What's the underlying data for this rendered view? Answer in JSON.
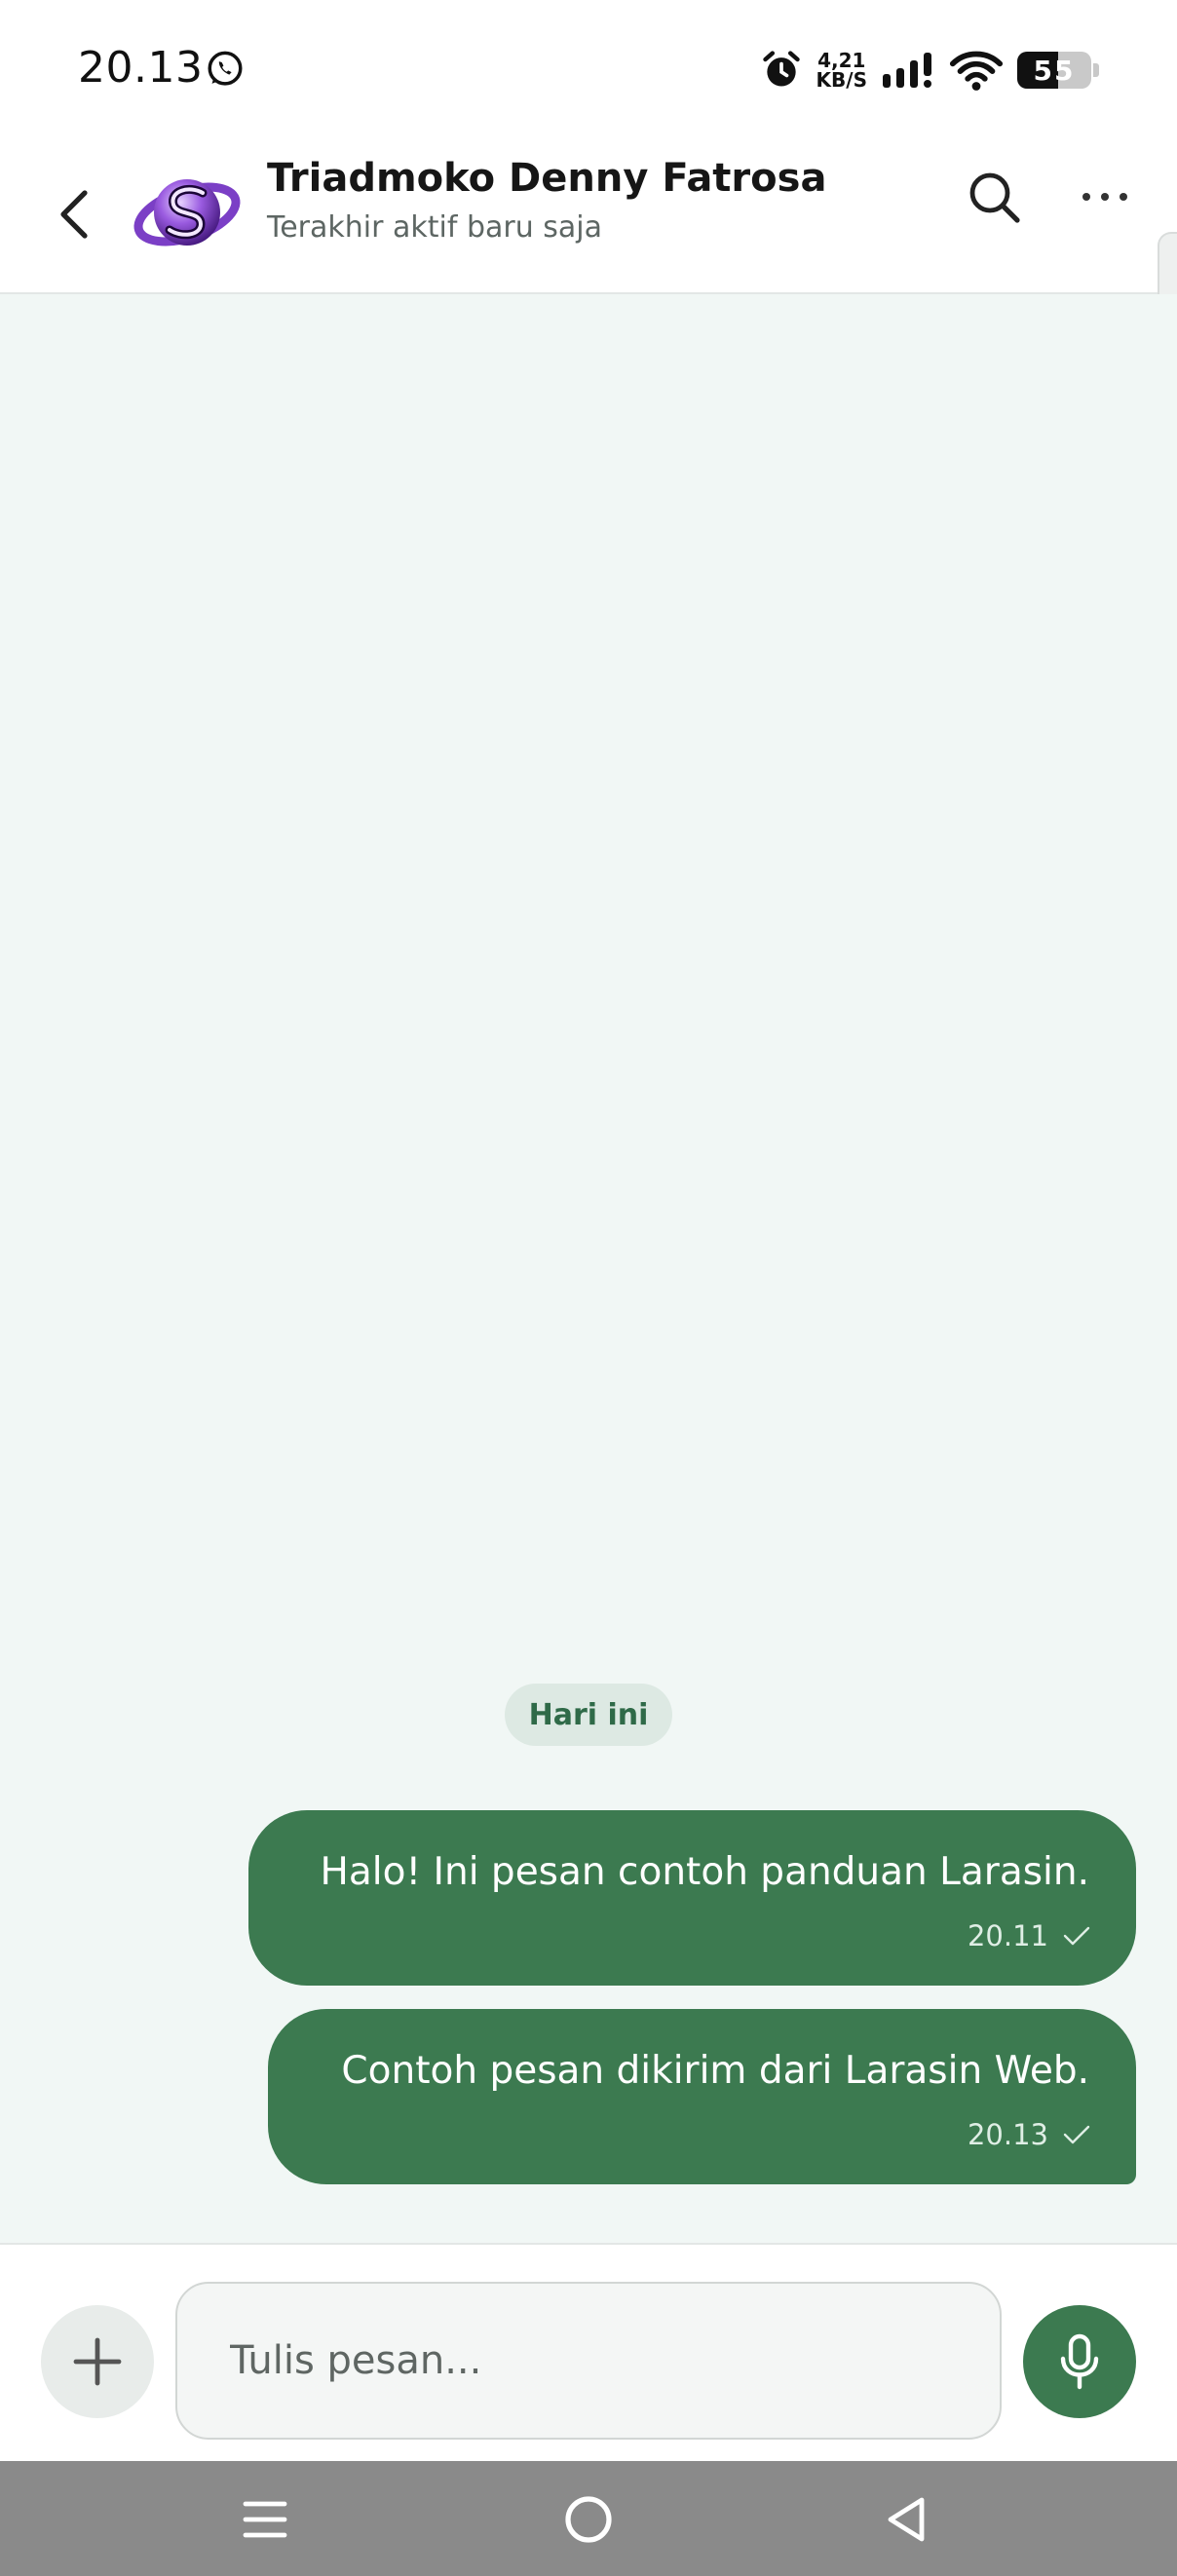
{
  "status_bar": {
    "time": "20.13",
    "net_speed_value": "4,21",
    "net_speed_unit": "KB/S",
    "battery_level": "55",
    "battery_fraction": 0.55,
    "icons": [
      "whatsapp-icon",
      "alarm-icon",
      "signal-icon",
      "wifi-icon",
      "battery-icon"
    ]
  },
  "header": {
    "contact_name": "Triadmoko Denny Fatrosa",
    "contact_status": "Terakhir aktif baru saja",
    "icons": [
      "back-arrow-icon",
      "search-icon",
      "more-icon"
    ]
  },
  "chat": {
    "date_label": "Hari ini",
    "messages": [
      {
        "text": "Halo! Ini pesan contoh panduan Larasin.",
        "time": "20.11"
      },
      {
        "text": "Contoh pesan dikirim dari Larasin Web.",
        "time": "20.13"
      }
    ]
  },
  "composer": {
    "placeholder": "Tulis pesan...",
    "value": "",
    "icons": [
      "plus-icon",
      "microphone-icon"
    ]
  },
  "nav_bar": {
    "icons": [
      "menu-icon",
      "home-icon",
      "back-icon"
    ]
  },
  "colors": {
    "accent": "#3c7a50",
    "chat_background": "#f1f7f5",
    "date_chip": "#dde9e3",
    "nav_bar": "#8a8a8a"
  }
}
